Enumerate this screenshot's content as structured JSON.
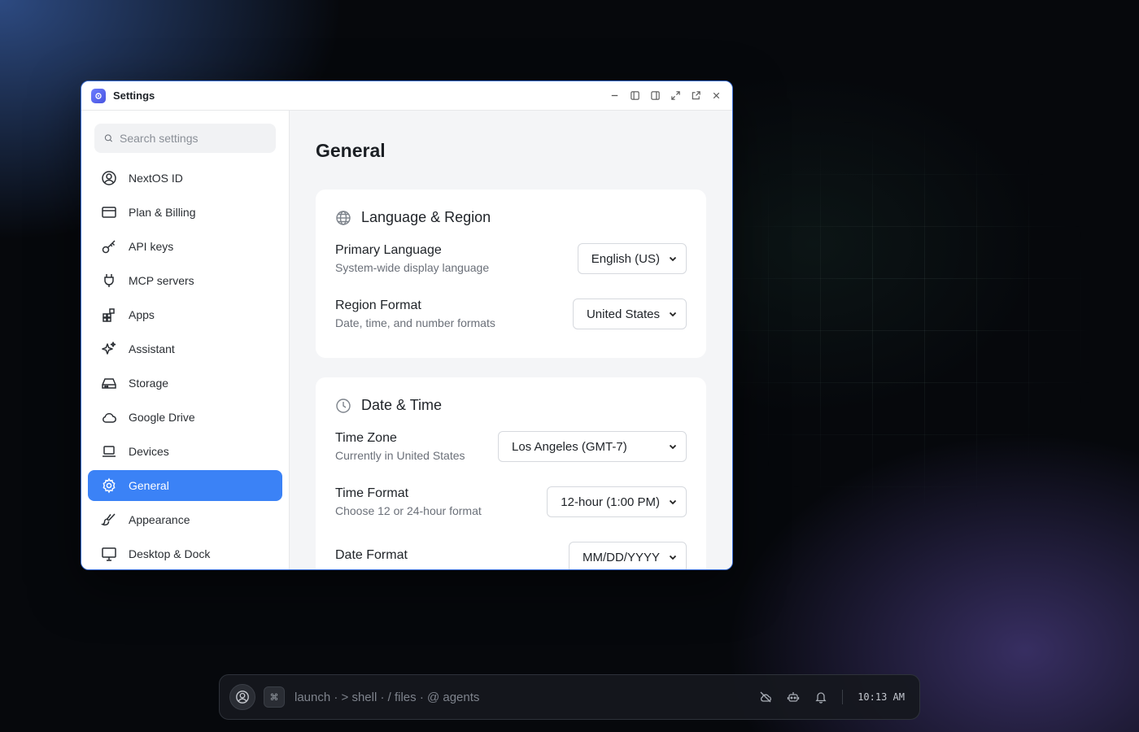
{
  "window": {
    "title": "Settings",
    "accent": "#3b82f6"
  },
  "search": {
    "placeholder": "Search settings"
  },
  "sidebar": {
    "items": [
      {
        "label": "NextOS ID",
        "icon": "user-circle-icon"
      },
      {
        "label": "Plan & Billing",
        "icon": "credit-card-icon"
      },
      {
        "label": "API keys",
        "icon": "key-icon"
      },
      {
        "label": "MCP servers",
        "icon": "plug-icon"
      },
      {
        "label": "Apps",
        "icon": "apps-icon"
      },
      {
        "label": "Assistant",
        "icon": "sparkles-icon"
      },
      {
        "label": "Storage",
        "icon": "hard-drive-icon"
      },
      {
        "label": "Google Drive",
        "icon": "cloud-icon"
      },
      {
        "label": "Devices",
        "icon": "laptop-icon"
      },
      {
        "label": "General",
        "icon": "gear-icon",
        "active": true
      },
      {
        "label": "Appearance",
        "icon": "paintbrush-icon"
      },
      {
        "label": "Desktop & Dock",
        "icon": "monitor-icon"
      }
    ]
  },
  "main": {
    "title": "General",
    "language_region": {
      "title": "Language & Region",
      "primary_language": {
        "label": "Primary Language",
        "sub": "System-wide display language",
        "value": "English (US)"
      },
      "region_format": {
        "label": "Region Format",
        "sub": "Date, time, and number formats",
        "value": "United States"
      }
    },
    "date_time": {
      "title": "Date & Time",
      "time_zone": {
        "label": "Time Zone",
        "sub": "Currently in United States",
        "value": "Los Angeles (GMT-7)"
      },
      "time_format": {
        "label": "Time Format",
        "sub": "Choose 12 or 24-hour format",
        "value": "12-hour (1:00 PM)"
      },
      "date_format": {
        "label": "Date Format",
        "value": "MM/DD/YYYY"
      }
    }
  },
  "dock": {
    "cmd_symbol": "⌘",
    "prompt": "launch · > shell · / files · @ agents",
    "time": "10:13 AM"
  }
}
